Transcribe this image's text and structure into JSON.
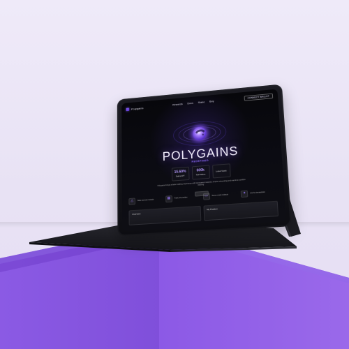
{
  "scene": {
    "background_color": "#ebe7f6",
    "pedestal_color": "#7d4ed9"
  },
  "tablet": {
    "brand": "Polygains",
    "nav": [
      "Rewards",
      "Docs",
      "Stake",
      "Buy"
    ],
    "wallet_button": "CONNECT WALLET",
    "headline": "POLYGAINS",
    "subheadline": "REDEFINED",
    "stats": [
      {
        "value": "15.60%",
        "label": "Staking APY"
      },
      {
        "value": "600k",
        "label": "Total Stakers"
      },
      {
        "value": "",
        "label": "Locked Supply"
      }
    ],
    "hero_copy": "Polygains brings a faster staking experience with transparent rewards, simple onboarding and real-time portfolio tracking.",
    "features": [
      {
        "icon": "triangle-icon",
        "label": "Stake and earn rewards"
      },
      {
        "icon": "grid-icon",
        "label": "Track your position"
      },
      {
        "icon": "card-icon",
        "label": "Secure smart contracts"
      },
      {
        "icon": "spark-icon",
        "label": "Low fee transactions"
      }
    ],
    "panels": [
      "Overview",
      "My Position"
    ]
  }
}
